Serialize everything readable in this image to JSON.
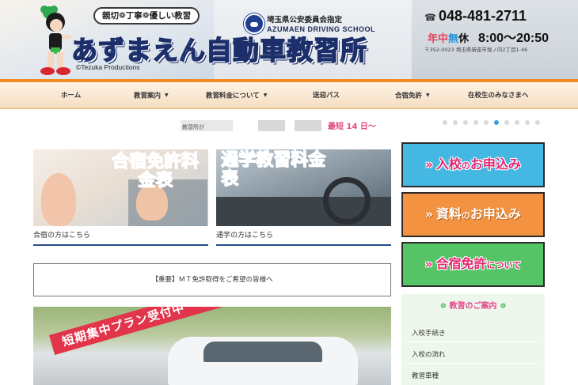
{
  "header": {
    "tagline": "親切❁丁寧❁優しい教習",
    "designated": "埼玉県公安委員会指定",
    "school_en": "AZUMAEN DRIVING SCHOOL",
    "brand": "あずまえん自動車教習所",
    "copyright": "©Tezuka Productions",
    "phone": "048-481-2711",
    "closed_label": "年中",
    "closed_char": "無",
    "closed_tail": "休",
    "hours": "8:00〜20:50",
    "address": "〒352-0023 埼玉県新座市堀ノ内2丁目1-46",
    "accent_orange": "#f08a24"
  },
  "nav": {
    "items": [
      {
        "label": "ホーム",
        "dropdown": false
      },
      {
        "label": "教習案内",
        "dropdown": true
      },
      {
        "label": "教習料金について",
        "dropdown": true
      },
      {
        "label": "送迎バス",
        "dropdown": false
      },
      {
        "label": "合宿免許",
        "dropdown": true
      },
      {
        "label": "在校生のみなさまへ",
        "dropdown": false
      }
    ]
  },
  "slider": {
    "label": "教習所が",
    "text": "最短 14 日〜",
    "dot_count": 10,
    "active_dot": 5
  },
  "banners": [
    {
      "title": "合宿免許料金表",
      "caption": "合宿の方はこちら"
    },
    {
      "title": "通学教習料金表",
      "caption": "通学の方はこちら"
    }
  ],
  "notice": {
    "text": "【重要】ＭＴ免許取得をご希望の皆様へ"
  },
  "promo": {
    "ribbon": "短期集中プラン受付中"
  },
  "sidebar": {
    "buttons": [
      {
        "main": "入校",
        "small": "の",
        "tail": "お申込み"
      },
      {
        "main": "資料",
        "small": "の",
        "tail": "お申込み"
      },
      {
        "main": "合宿免許",
        "small": "について",
        "tail": ""
      }
    ],
    "guide_title": "教習のご案内",
    "guide_items": [
      "入校手続き",
      "入校の流れ",
      "教習車種"
    ]
  }
}
